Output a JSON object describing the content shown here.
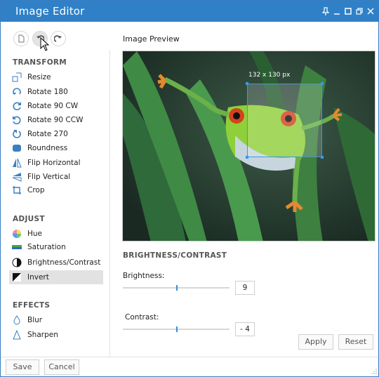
{
  "window": {
    "title": "Image Editor"
  },
  "toolbar": {
    "new_icon": "document-icon",
    "undo_icon": "undo-icon",
    "redo_icon": "redo-icon"
  },
  "sidebar": {
    "sections": [
      {
        "title": "TRANSFORM",
        "items": [
          "Resize",
          "Rotate 180",
          "Rotate 90 CW",
          "Rotate 90 CCW",
          "Rotate 270",
          "Roundness",
          "Flip Horizontal",
          "Flip Vertical",
          "Crop"
        ]
      },
      {
        "title": "ADJUST",
        "items": [
          "Hue",
          "Saturation",
          "Brightness/Contrast",
          "Invert"
        ]
      },
      {
        "title": "EFFECTS",
        "items": [
          "Blur",
          "Sharpen"
        ]
      }
    ],
    "selected": "Invert"
  },
  "preview": {
    "title": "Image Preview",
    "crop_size": "132 x 130 px"
  },
  "brightness_contrast": {
    "title": "BRIGHTNESS/CONTRAST",
    "brightness_label": "Brightness:",
    "brightness_value": "9",
    "brightness_level": 0.5,
    "contrast_label": "Contrast:",
    "contrast_value": "- 4",
    "contrast_level": 0.5,
    "apply_label": "Apply",
    "reset_label": "Reset"
  },
  "footer": {
    "save_label": "Save",
    "cancel_label": "Cancel"
  },
  "colors": {
    "titlebar": "#2f80c7",
    "accent": "#3a8fd6",
    "selected_bg": "#e2e2e2"
  }
}
